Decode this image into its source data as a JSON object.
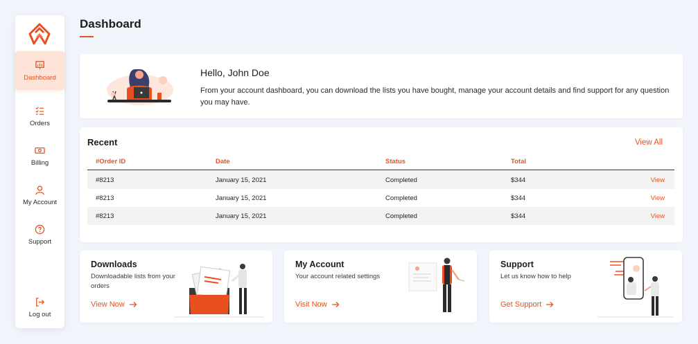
{
  "sidebar": {
    "items": [
      {
        "label": "Dashboard",
        "icon": "presentation-chart-icon"
      },
      {
        "label": "Orders",
        "icon": "checklist-icon"
      },
      {
        "label": "Billing",
        "icon": "cash-icon"
      },
      {
        "label": "My Account",
        "icon": "user-icon"
      },
      {
        "label": "Support",
        "icon": "help-circle-icon"
      },
      {
        "label": "Log out",
        "icon": "logout-icon"
      }
    ]
  },
  "header": {
    "title": "Dashboard"
  },
  "welcome": {
    "greeting": "Hello, John Doe",
    "message": "From your account dashboard, you can download the lists you have bought, manage your account details and find support for any question you may have."
  },
  "recent": {
    "title": "Recent",
    "view_all": "View All",
    "columns": [
      "#Order ID",
      "Date",
      "Status",
      "Total"
    ],
    "rows": [
      {
        "id": "#8213",
        "date": "January 15, 2021",
        "status": "Completed",
        "total": "$344",
        "action": "View"
      },
      {
        "id": "#8213",
        "date": "January 15, 2021",
        "status": "Completed",
        "total": "$344",
        "action": "View"
      },
      {
        "id": "#8213",
        "date": "January 15, 2021",
        "status": "Completed",
        "total": "$344",
        "action": "View"
      }
    ]
  },
  "cards": [
    {
      "title": "Downloads",
      "desc": "Downloadable lists from your orders",
      "link": "View Now"
    },
    {
      "title": "My Account",
      "desc": "Your account related settings",
      "link": "Visit Now"
    },
    {
      "title": "Support",
      "desc": "Let us know how to help",
      "link": "Get Support"
    }
  ],
  "colors": {
    "accent": "#e8511f",
    "background": "#f1f4fb",
    "active_bg": "#fde3d8"
  }
}
